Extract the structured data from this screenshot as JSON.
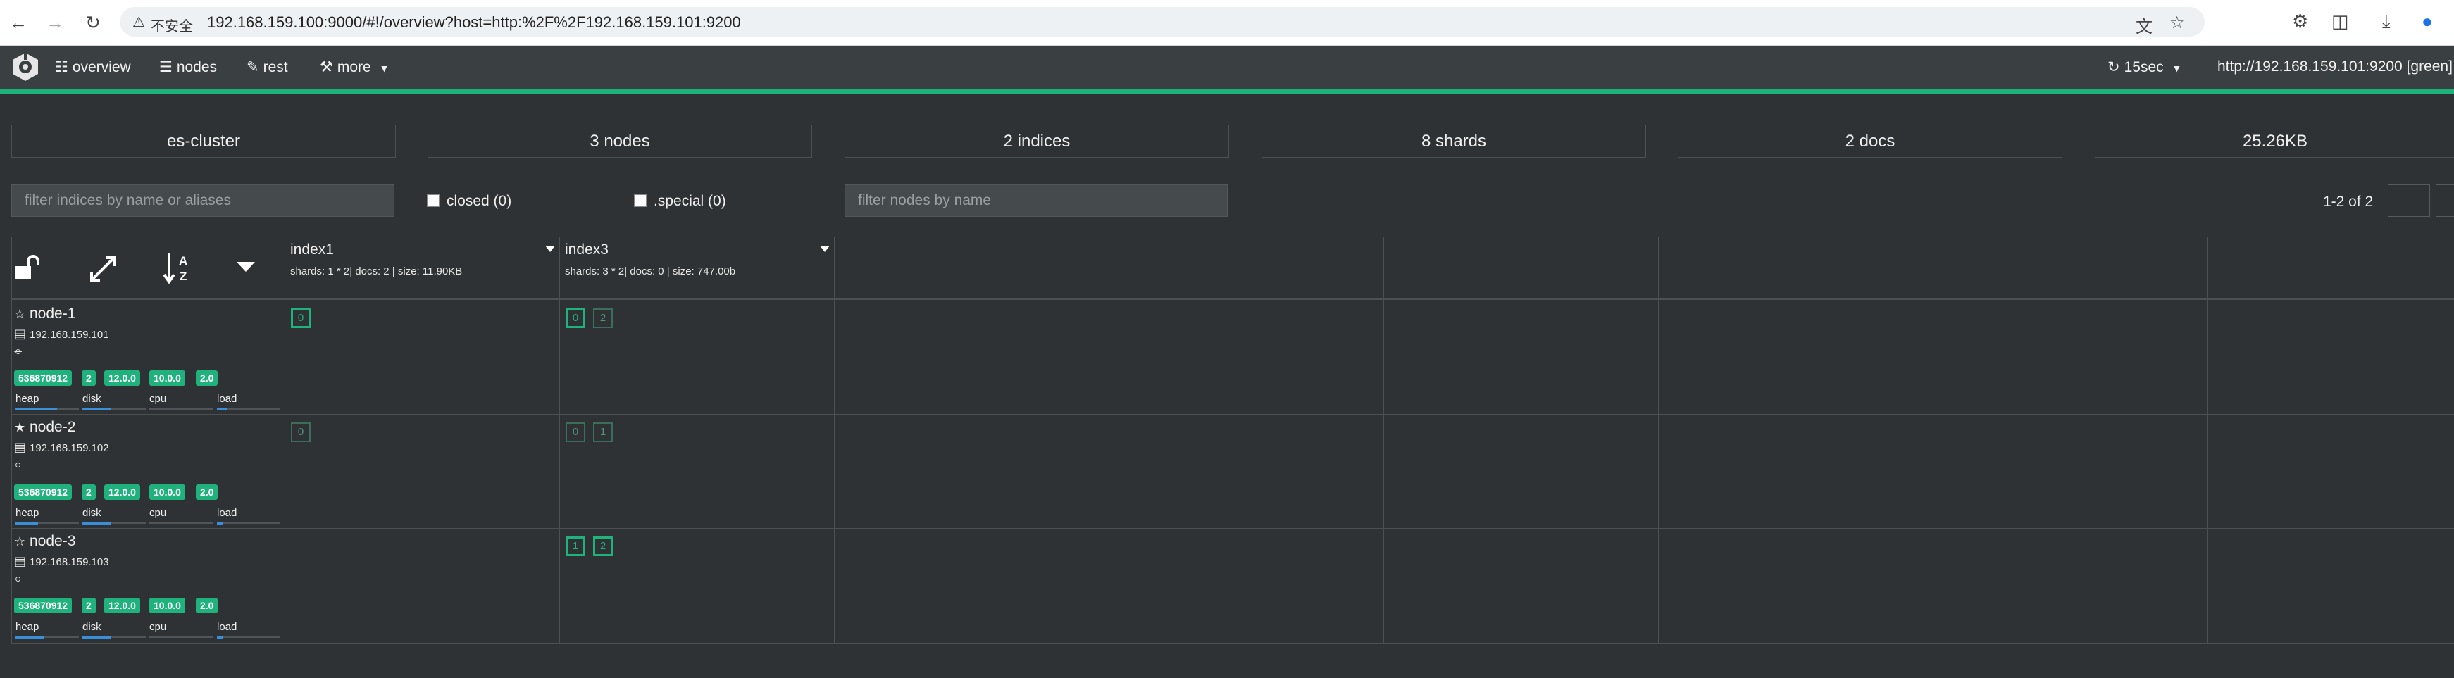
{
  "browser": {
    "security_label": "不安全",
    "url": "192.168.159.100:9000/#!/overview?host=http:%2F%2F192.168.159.101:9200"
  },
  "header": {
    "menu": {
      "overview": "overview",
      "nodes": "nodes",
      "rest": "rest",
      "more": "more"
    },
    "refresh_interval": "15sec",
    "cluster_url": "http://192.168.159.101:9200 [green]",
    "accent_color": "#1fb27c"
  },
  "stats": {
    "cluster_name": "es-cluster",
    "nodes": "3 nodes",
    "indices": "2 indices",
    "shards": "8 shards",
    "docs": "2 docs",
    "size": "25.26KB"
  },
  "filters": {
    "indices_placeholder": "filter indices by name or aliases",
    "closed_label": "closed (0)",
    "special_label": ".special (0)",
    "nodes_placeholder": "filter nodes by name",
    "pagination": "1-2 of 2"
  },
  "indices": [
    {
      "name": "index1",
      "meta": "shards: 1 * 2| docs: 2 | size: 11.90KB"
    },
    {
      "name": "index3",
      "meta": "shards: 3 * 2| docs: 0 | size: 747.00b"
    }
  ],
  "metric_labels": {
    "heap": "heap",
    "disk": "disk",
    "cpu": "cpu",
    "load": "load"
  },
  "nodes": [
    {
      "name": "node-1",
      "ip": "192.168.159.101",
      "master": false,
      "badges": [
        "536870912",
        "2",
        "12.0.0",
        "10.0.0",
        "2.0"
      ],
      "metrics": {
        "heap": 0.65,
        "disk": 0.45,
        "cpu": 0.0,
        "load": 0.15
      },
      "shards": {
        "index1": [
          {
            "n": "0",
            "primary": true
          }
        ],
        "index3": [
          {
            "n": "0",
            "primary": true
          },
          {
            "n": "2",
            "primary": false
          }
        ]
      }
    },
    {
      "name": "node-2",
      "ip": "192.168.159.102",
      "master": true,
      "badges": [
        "536870912",
        "2",
        "12.0.0",
        "10.0.0",
        "2.0"
      ],
      "metrics": {
        "heap": 0.35,
        "disk": 0.45,
        "cpu": 0.0,
        "load": 0.1
      },
      "shards": {
        "index1": [
          {
            "n": "0",
            "primary": false
          }
        ],
        "index3": [
          {
            "n": "0",
            "primary": false
          },
          {
            "n": "1",
            "primary": false
          }
        ]
      }
    },
    {
      "name": "node-3",
      "ip": "192.168.159.103",
      "master": false,
      "badges": [
        "536870912",
        "2",
        "12.0.0",
        "10.0.0",
        "2.0"
      ],
      "metrics": {
        "heap": 0.45,
        "disk": 0.45,
        "cpu": 0.0,
        "load": 0.1
      },
      "shards": {
        "index1": [],
        "index3": [
          {
            "n": "1",
            "primary": true
          },
          {
            "n": "2",
            "primary": true
          }
        ]
      }
    }
  ]
}
